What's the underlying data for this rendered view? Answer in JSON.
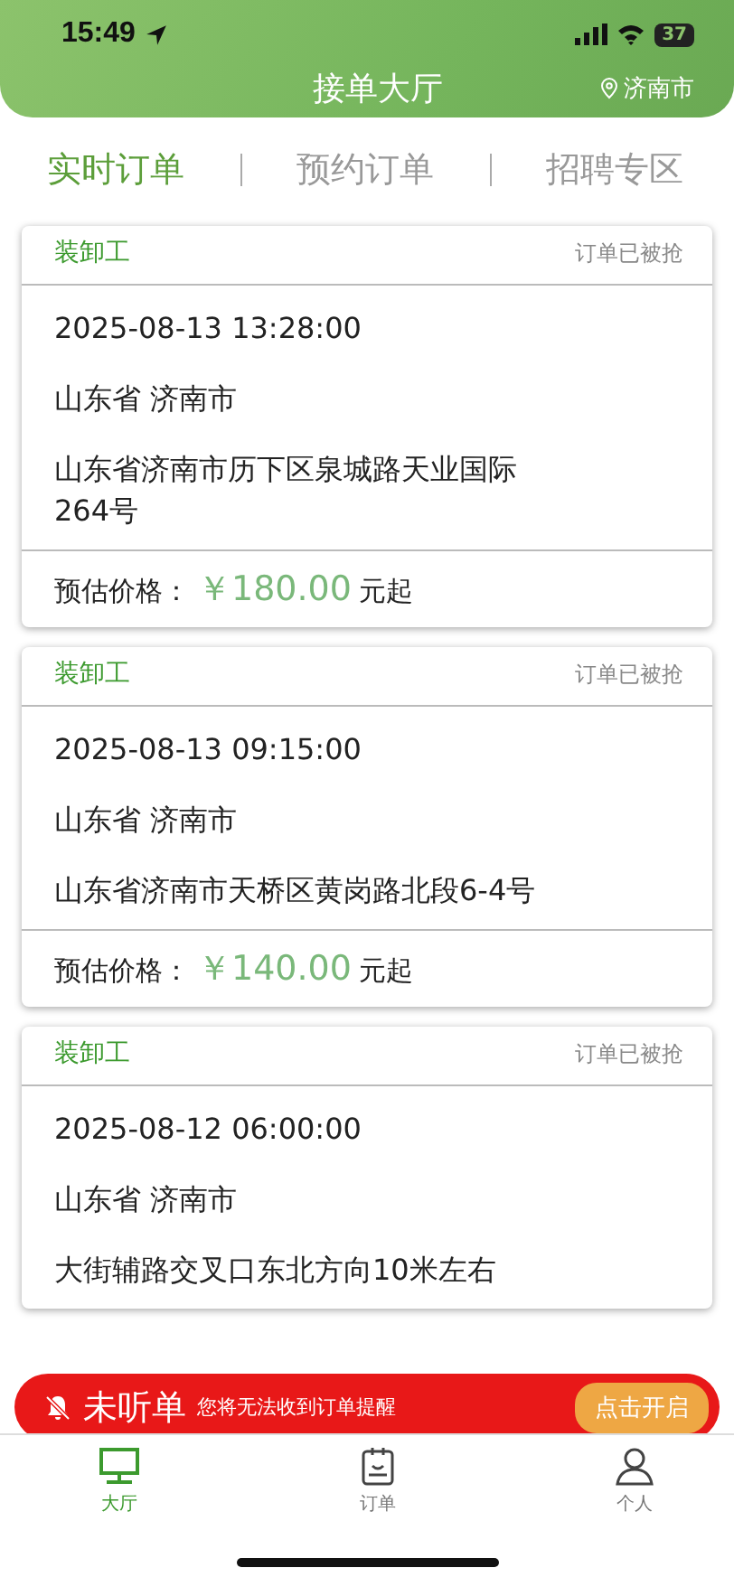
{
  "status_bar": {
    "time": "15:49",
    "battery": "37"
  },
  "header": {
    "title": "接单大厅",
    "location": "济南市"
  },
  "tabs": [
    {
      "label": "实时订单",
      "selected": true
    },
    {
      "label": "预约订单",
      "selected": false
    },
    {
      "label": "招聘专区",
      "selected": false
    }
  ],
  "orders": [
    {
      "job": "装卸工",
      "status": "订单已被抢",
      "time": "2025-08-13 13:28:00",
      "region": "山东省 济南市",
      "address": "山东省济南市历下区泉城路天业国际264号",
      "price_label": "预估价格：",
      "price": "￥180.00",
      "price_suffix": "元起"
    },
    {
      "job": "装卸工",
      "status": "订单已被抢",
      "time": "2025-08-13 09:15:00",
      "region": "山东省 济南市",
      "address": "山东省济南市天桥区黄岗路北段6-4号",
      "price_label": "预估价格：",
      "price": "￥140.00",
      "price_suffix": "元起"
    },
    {
      "job": "装卸工",
      "status": "订单已被抢",
      "time": "2025-08-12 06:00:00",
      "region": "山东省 济南市",
      "address": "大街辅路交叉口东北方向10米左右"
    }
  ],
  "banner": {
    "title": "未听单",
    "message": "您将无法收到订单提醒",
    "button": "点击开启"
  },
  "nav": [
    {
      "label": "大厅",
      "kind": "screen",
      "selected": true
    },
    {
      "label": "订单",
      "kind": "clipboard",
      "selected": false
    },
    {
      "label": "个人",
      "kind": "person",
      "selected": false
    }
  ]
}
